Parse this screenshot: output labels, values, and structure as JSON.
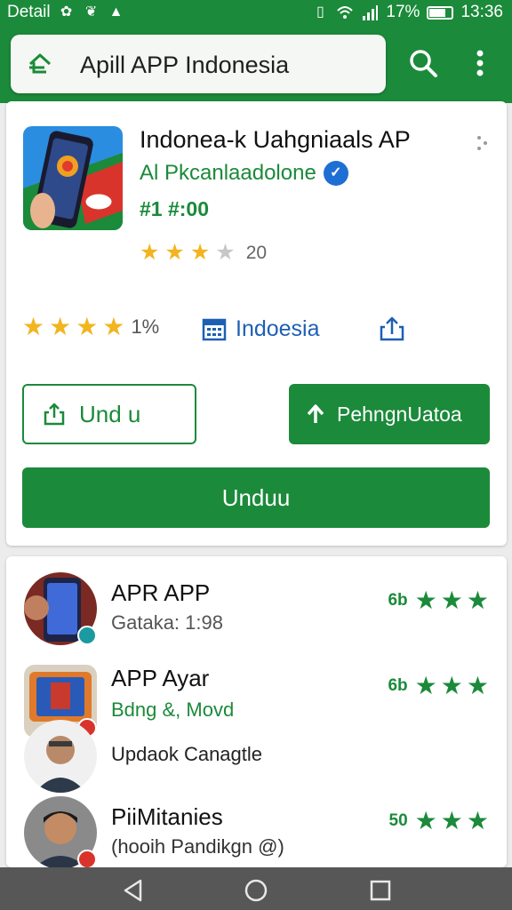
{
  "status_bar": {
    "label": "Detail",
    "battery": "17%",
    "time": "13:36",
    "icons": [
      "pinwheel-icon",
      "paw-icon",
      "graduation-cap-icon",
      "vibrate-icon",
      "wifi-icon",
      "signal-icon",
      "battery-icon"
    ]
  },
  "app_bar": {
    "search_query": "Apill APP Indonesia",
    "icons": [
      "home-back-icon",
      "search-icon",
      "more-vertical-icon"
    ]
  },
  "app_detail": {
    "title": "Indonea-k Uahgniaals AP",
    "developer": "Al Pkcanlaadolone",
    "verified_icon": "verified-check-icon",
    "price": "#1 #:00",
    "small_rating": {
      "stars": 3,
      "count": "20"
    },
    "meta": {
      "rating_stars": 4,
      "rating_count": "1%",
      "region_icon": "calendar-grid-icon",
      "region": "Indoesia",
      "share_icon": "share-icon"
    },
    "buttons": {
      "share_label": "Und u",
      "update_label": "PehngnUatoa",
      "install_label": "Unduu"
    }
  },
  "related_apps": [
    {
      "title": "APR APP",
      "subtitle": "Gataka: 1:98",
      "subtitle_green": false,
      "rating_num": "6b",
      "stars": 3
    },
    {
      "title": "APP Ayar",
      "subtitle": "Bdng &, Movd",
      "subtitle_green": true,
      "rating_num": "6b",
      "stars": 3
    },
    {
      "title": "",
      "subtitle": "Updaok Canagtle",
      "subtitle_green": false,
      "rating_num": "",
      "stars": 0
    },
    {
      "title": "PiiMitanies",
      "subtitle": "(hooih Pandikgn @)",
      "subtitle_green": false,
      "rating_num": "50",
      "stars": 3
    }
  ],
  "colors": {
    "primary": "#1b8a3a",
    "star_gold": "#f2b51f",
    "link_blue": "#1e5fb4",
    "nav_bar": "#575757"
  },
  "nav_bar": {
    "icons": [
      "back-triangle-icon",
      "home-circle-icon",
      "recents-square-icon"
    ]
  }
}
